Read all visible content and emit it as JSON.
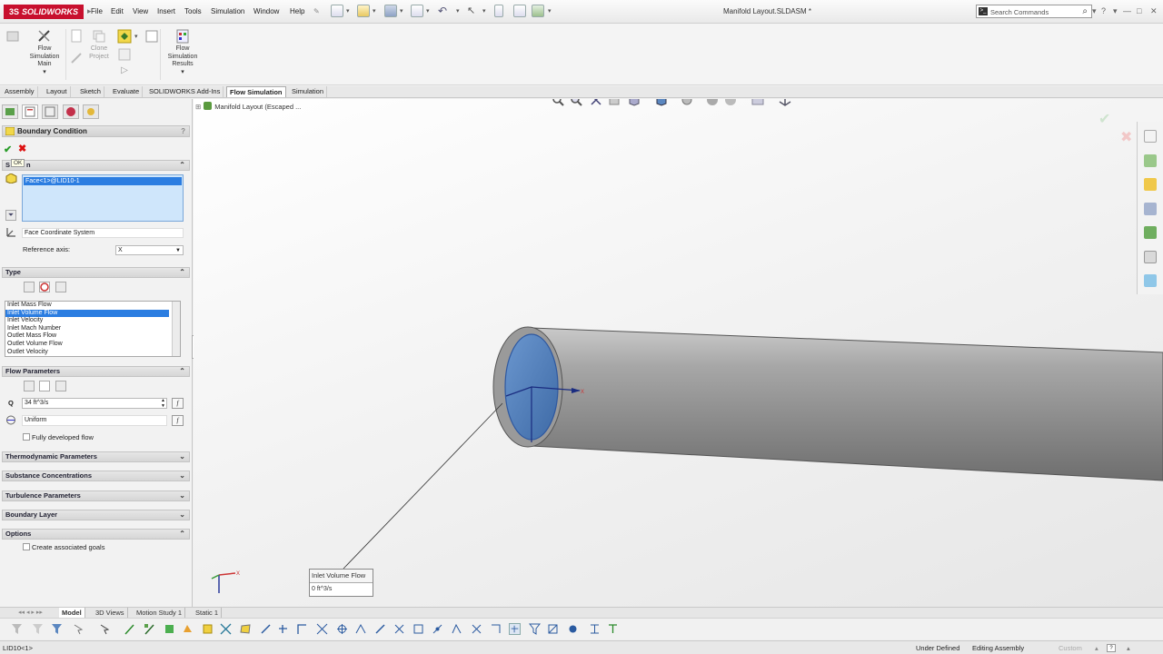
{
  "app": {
    "logo": "SOLIDWORKS",
    "menu": [
      "File",
      "Edit",
      "View",
      "Insert",
      "Tools",
      "Simulation",
      "Window",
      "Help"
    ],
    "document_title": "Manifold Layout.SLDASM *",
    "search_placeholder": "Search Commands",
    "window_controls": [
      "?",
      "▾",
      "—",
      "□",
      "✕"
    ]
  },
  "ribbon": {
    "flow_simulation_main": "Flow Simulation Main",
    "clone_project": "Clone Project",
    "flow_simulation_results": "Flow Simulation Results"
  },
  "tabs": [
    {
      "label": "Assembly"
    },
    {
      "label": "Layout"
    },
    {
      "label": "Sketch"
    },
    {
      "label": "Evaluate"
    },
    {
      "label": "SOLIDWORKS Add-Ins"
    },
    {
      "label": "Flow Simulation",
      "active": true
    },
    {
      "label": "Simulation"
    }
  ],
  "property_manager": {
    "title": "Boundary Condition",
    "help": "?",
    "ok_tooltip": "OK",
    "selection": {
      "header": "S",
      "header_tail": "n",
      "selected_item": "Face<1>@LID10-1",
      "coordinate_system": "Face Coordinate System",
      "reference_axis_label": "Reference axis:",
      "reference_axis_value": "X"
    },
    "type": {
      "header": "Type",
      "options": [
        "Inlet Mass Flow",
        "Inlet Volume Flow",
        "Inlet Velocity",
        "Inlet Mach Number",
        "Outlet Mass Flow",
        "Outlet Volume Flow",
        "Outlet Velocity"
      ],
      "selected": "Inlet Volume Flow"
    },
    "flow_parameters": {
      "header": "Flow Parameters",
      "q_label": "Q",
      "q_value": "34 ft^3/s",
      "profile": "Uniform",
      "fx": "f",
      "fully_developed_label": "Fully developed flow"
    },
    "collapsed_sections": [
      "Thermodynamic Parameters",
      "Substance Concentrations",
      "Turbulence Parameters",
      "Boundary Layer"
    ],
    "options": {
      "header": "Options",
      "create_goals_label": "Create associated goals"
    }
  },
  "viewport": {
    "breadcrumb": "Manifold Layout  (Escaped ...",
    "callout_title": "Inlet Volume Flow",
    "callout_value": "0 ft^3/s",
    "pipe_color": "#8c8c8c",
    "face_color": "#5b87c0"
  },
  "bottom_tabs": [
    {
      "label": "Model",
      "active": true
    },
    {
      "label": "3D Views"
    },
    {
      "label": "Motion Study 1"
    },
    {
      "label": "Static 1"
    }
  ],
  "status": {
    "selection": "LID10<1>",
    "definition": "Under Defined",
    "mode": "Editing Assembly",
    "units": "Custom"
  }
}
